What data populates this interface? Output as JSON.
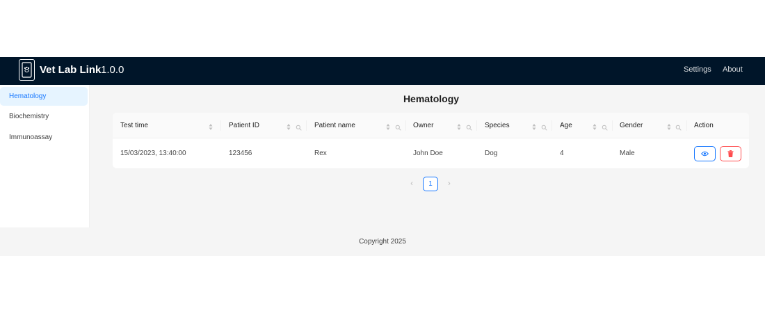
{
  "header": {
    "brand": "Vet Lab Link",
    "version": "1.0.0",
    "nav": [
      "Settings",
      "About"
    ]
  },
  "sidebar": {
    "items": [
      {
        "label": "Hematology",
        "active": true
      },
      {
        "label": "Biochemistry",
        "active": false
      },
      {
        "label": "Immunoassay",
        "active": false
      }
    ]
  },
  "main": {
    "title": "Hematology",
    "table": {
      "columns": [
        "Test time",
        "Patient ID",
        "Patient name",
        "Owner",
        "Species",
        "Age",
        "Gender",
        "Action"
      ],
      "rows": [
        [
          "15/03/2023, 13:40:00",
          "123456",
          "Rex",
          "John Doe",
          "Dog",
          "4",
          "Male"
        ]
      ]
    },
    "pagination": {
      "current": "1"
    }
  },
  "footer": {
    "text": "Copyright 2025"
  },
  "colors": {
    "header_bg": "#001529",
    "primary": "#1677ff",
    "danger": "#ff4d4f",
    "content_bg": "#f5f5f5",
    "active_menu_bg": "#e6f4ff"
  },
  "icons": {
    "logo": "paw-document-icon",
    "sort": "sort-caret-icon",
    "filter": "search-icon",
    "view": "eye-icon",
    "delete": "trash-icon",
    "prev": "chevron-left-icon",
    "next": "chevron-right-icon"
  }
}
